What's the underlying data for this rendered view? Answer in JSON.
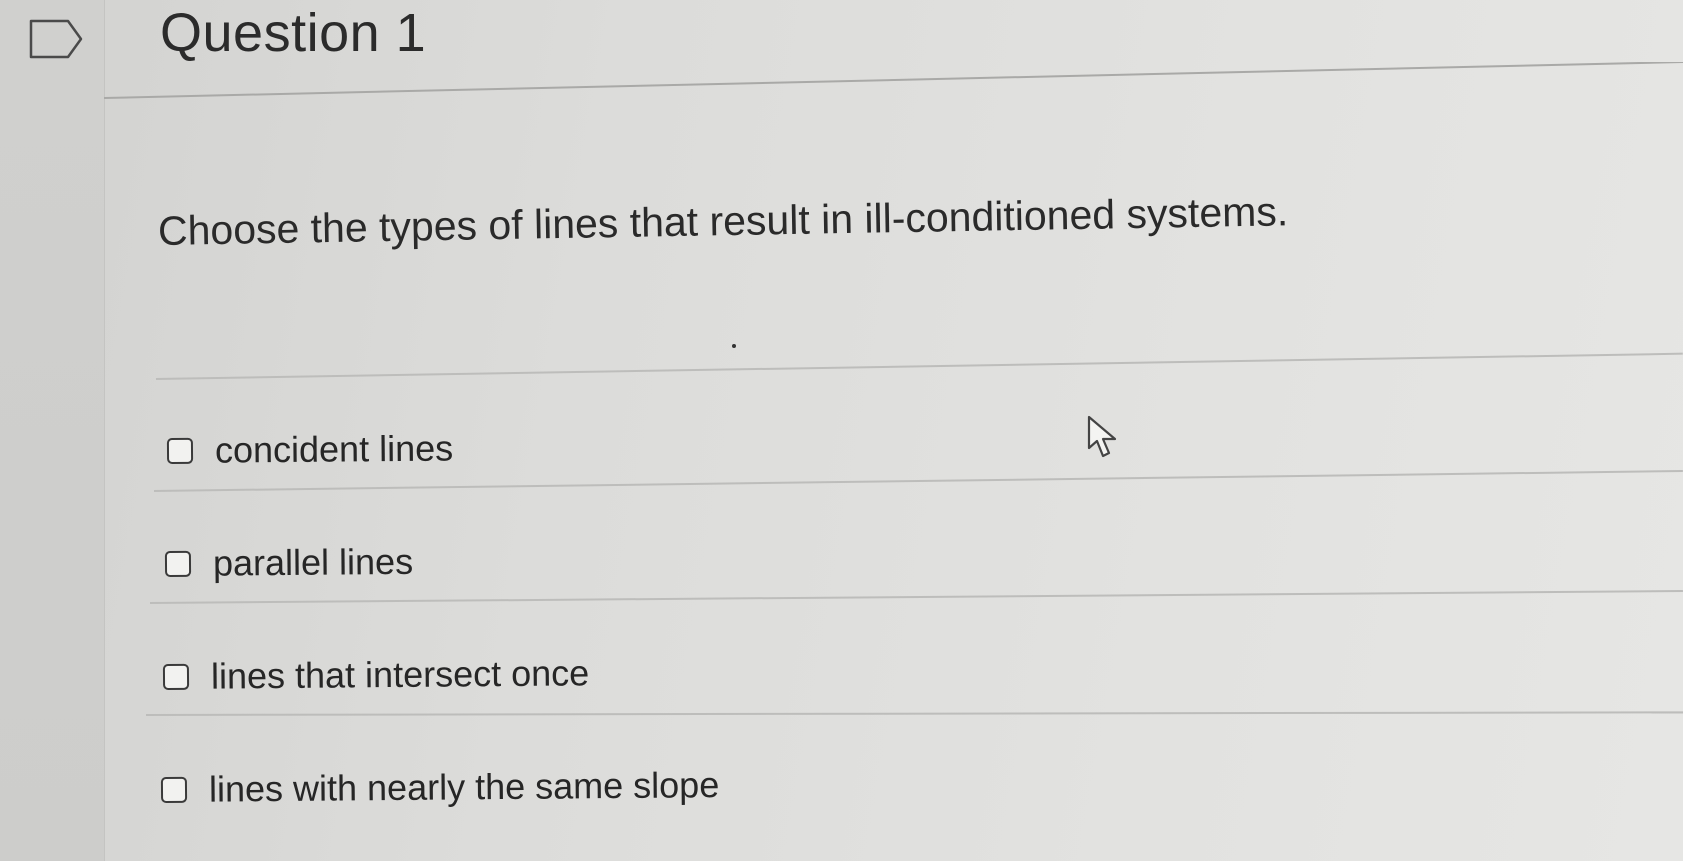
{
  "question": {
    "title": "Question 1",
    "prompt": "Choose the types of lines that result in ill-conditioned systems."
  },
  "icons": {
    "flag": "flag-outline-icon",
    "cursor": "mouse-pointer-icon"
  },
  "options": [
    {
      "label": "concident lines",
      "checked": false
    },
    {
      "label": "parallel lines",
      "checked": false
    },
    {
      "label": "lines that intersect once",
      "checked": false
    },
    {
      "label": "lines with nearly the same slope",
      "checked": false
    }
  ]
}
